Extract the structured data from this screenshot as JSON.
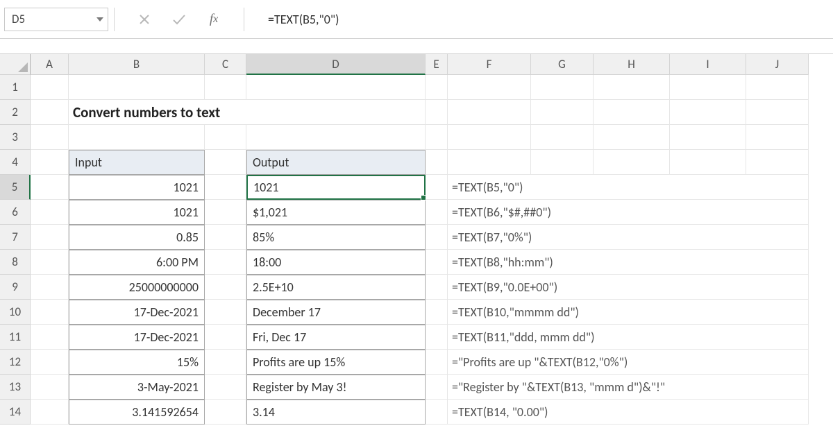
{
  "nameBox": "D5",
  "formula": "=TEXT(B5,\"0\")",
  "columns": [
    "A",
    "B",
    "C",
    "D",
    "E",
    "F",
    "G",
    "H",
    "I",
    "J"
  ],
  "rows": [
    "1",
    "2",
    "3",
    "4",
    "5",
    "6",
    "7",
    "8",
    "9",
    "10",
    "11",
    "12",
    "13",
    "14"
  ],
  "title": "Convert numbers to text",
  "table": {
    "header": {
      "input": "Input",
      "output": "Output"
    },
    "data": [
      {
        "input": "1021",
        "output": "1021",
        "formula": "=TEXT(B5,\"0\")"
      },
      {
        "input": "1021",
        "output": "$1,021",
        "formula": "=TEXT(B6,\"$#,##0\")"
      },
      {
        "input": "0.85",
        "output": "85%",
        "formula": "=TEXT(B7,\"0%\")"
      },
      {
        "input": "6:00 PM",
        "output": "18:00",
        "formula": "=TEXT(B8,\"hh:mm\")"
      },
      {
        "input": "25000000000",
        "output": "2.5E+10",
        "formula": "=TEXT(B9,\"0.0E+00\")"
      },
      {
        "input": "17-Dec-2021",
        "output": "December 17",
        "formula": "=TEXT(B10,\"mmmm dd\")"
      },
      {
        "input": "17-Dec-2021",
        "output": "Fri, Dec 17",
        "formula": "=TEXT(B11,\"ddd, mmm dd\")"
      },
      {
        "input": "15%",
        "output": "Profits are up 15%",
        "formula": "=\"Profits are up \"&TEXT(B12,\"0%\")"
      },
      {
        "input": "3-May-2021",
        "output": "Register by May 3!",
        "formula": "=\"Register by \"&TEXT(B13, \"mmm d\")&\"!\""
      },
      {
        "input": "3.141592654",
        "output": "3.14",
        "formula": "=TEXT(B14, \"0.00\")"
      }
    ]
  }
}
